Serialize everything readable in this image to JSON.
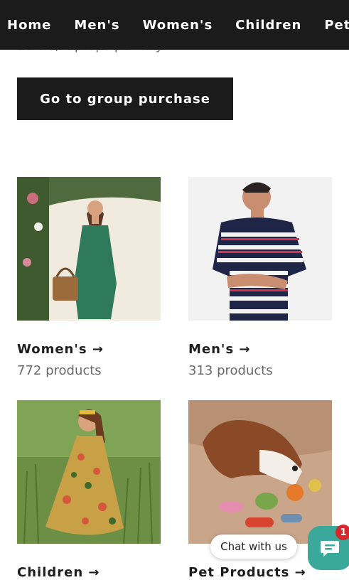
{
  "nav": {
    "items": [
      {
        "label": "Home"
      },
      {
        "label": "Men's"
      },
      {
        "label": "Women's"
      },
      {
        "label": "Children"
      },
      {
        "label": "Pet Pr"
      }
    ]
  },
  "intro": {
    "partial_text": "series, laptops per day."
  },
  "cta": {
    "label": "Go to group purchase"
  },
  "collections": [
    {
      "title": "Women's →",
      "count": "772 products",
      "image": "woman-in-green-dress"
    },
    {
      "title": "Men's →",
      "count": "313 products",
      "image": "man-in-striped-tshirt"
    },
    {
      "title": "Children →",
      "count": "",
      "image": "girl-in-floral-dress"
    },
    {
      "title": "Pet Products →",
      "count": "",
      "image": "dog-with-toys"
    }
  ],
  "chat": {
    "label": "Chat with us",
    "badge": "1",
    "accent": "#3aa89a"
  }
}
